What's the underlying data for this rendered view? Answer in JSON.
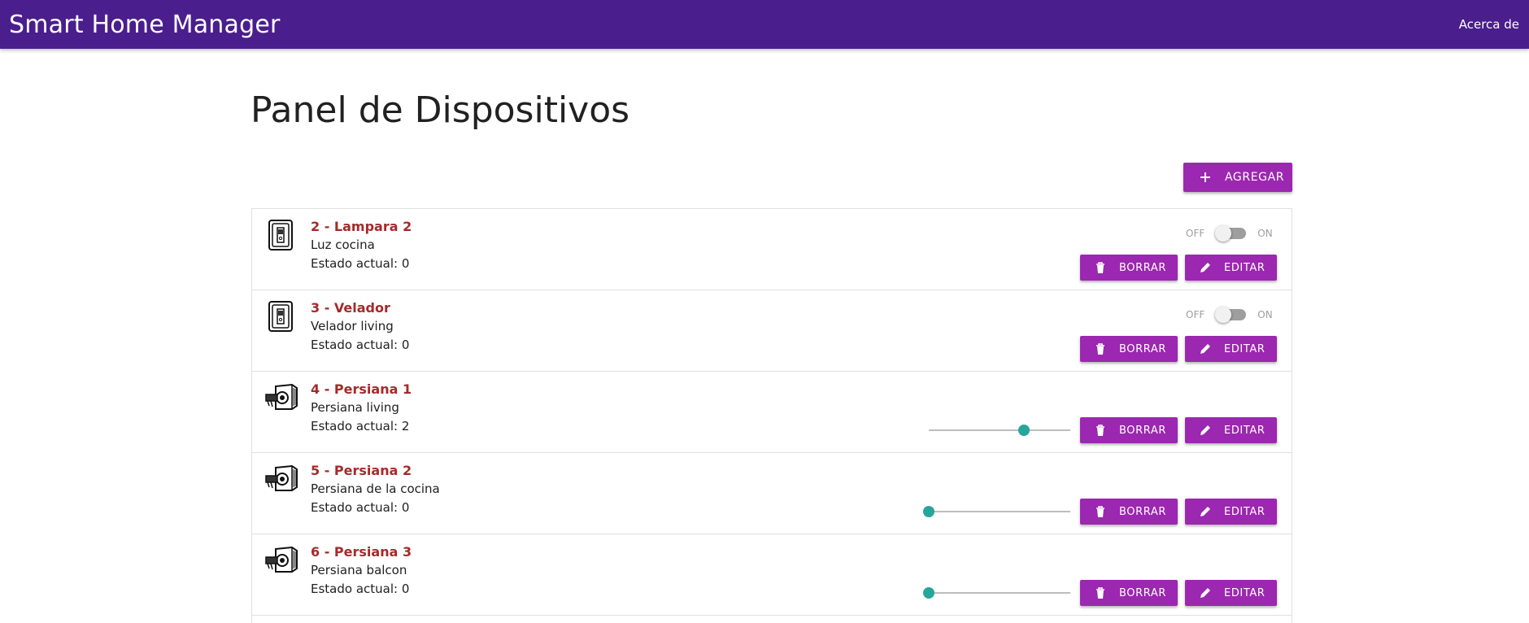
{
  "navbar": {
    "brand": "Smart Home Manager",
    "about_link": "Acerca de"
  },
  "page": {
    "title": "Panel de Dispositivos",
    "add_button": "AGREGAR"
  },
  "colors": {
    "navbar": "#4a1e8c",
    "button": "#9c27b0",
    "device_title": "#a52a2a",
    "slider_accent": "#26a69a"
  },
  "devices": [
    {
      "title": "2 - Lampara 2",
      "description": "Luz cocina",
      "state_text": "Estado actual: 0",
      "icon": "light-switch-icon",
      "control": "switch",
      "switch_off_label": "OFF",
      "switch_on_label": "ON",
      "switch_on": false,
      "delete_label": "BORRAR",
      "edit_label": "EDITAR"
    },
    {
      "title": "3 - Velador",
      "description": "Velador living",
      "state_text": "Estado actual: 0",
      "icon": "light-switch-icon",
      "control": "switch",
      "switch_off_label": "OFF",
      "switch_on_label": "ON",
      "switch_on": false,
      "delete_label": "BORRAR",
      "edit_label": "EDITAR"
    },
    {
      "title": "4 - Persiana 1",
      "description": "Persiana living",
      "state_text": "Estado actual: 2",
      "icon": "blind-motor-icon",
      "control": "slider",
      "slider_value": 0.67,
      "delete_label": "BORRAR",
      "edit_label": "EDITAR"
    },
    {
      "title": "5 - Persiana 2",
      "description": "Persiana de la cocina",
      "state_text": "Estado actual: 0",
      "icon": "blind-motor-icon",
      "control": "slider",
      "slider_value": 0,
      "delete_label": "BORRAR",
      "edit_label": "EDITAR"
    },
    {
      "title": "6 - Persiana 3",
      "description": "Persiana balcon",
      "state_text": "Estado actual: 0",
      "icon": "blind-motor-icon",
      "control": "slider",
      "slider_value": 0,
      "delete_label": "BORRAR",
      "edit_label": "EDITAR"
    }
  ]
}
